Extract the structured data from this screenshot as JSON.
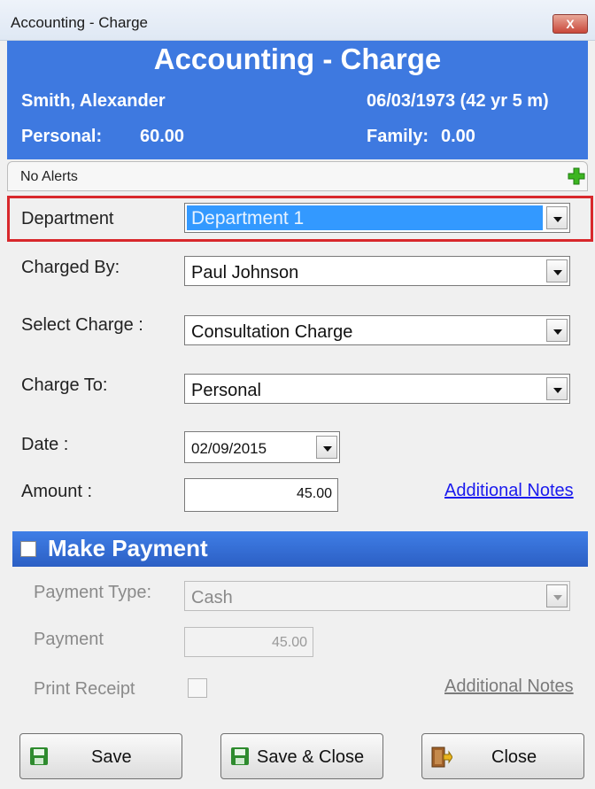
{
  "window": {
    "title": "Accounting - Charge",
    "close_glyph": "X"
  },
  "header": {
    "title": "Accounting - Charge",
    "patient_name": "Smith, Alexander",
    "dob": "06/03/1973 (42 yr 5 m)",
    "personal_label": "Personal:",
    "personal_value": "60.00",
    "family_label": "Family:",
    "family_value": "0.00"
  },
  "alerts": {
    "text": "No Alerts",
    "add_icon": "plus-icon"
  },
  "form": {
    "department": {
      "label": "Department",
      "value": "Department 1"
    },
    "charged_by": {
      "label": "Charged By:",
      "value": "Paul Johnson"
    },
    "select_charge": {
      "label": "Select Charge :",
      "value": "Consultation Charge"
    },
    "charge_to": {
      "label": "Charge To:",
      "value": "Personal"
    },
    "date": {
      "label": "Date :",
      "value": "02/09/2015"
    },
    "amount": {
      "label": "Amount :",
      "value": "45.00"
    },
    "notes_link": "Additional Notes"
  },
  "payment": {
    "section_title": "Make Payment",
    "checked": false,
    "type_label": "Payment Type:",
    "type_value": "Cash",
    "payment_label": "Payment",
    "payment_value": "45.00",
    "print_label": "Print Receipt",
    "notes_link": "Additional Notes"
  },
  "buttons": {
    "save": "Save",
    "save_close": "Save & Close",
    "close": "Close"
  },
  "colors": {
    "header": "#3e79e0",
    "highlight": "#d8282c",
    "selection": "#3399ff",
    "link": "#1a1aee"
  }
}
